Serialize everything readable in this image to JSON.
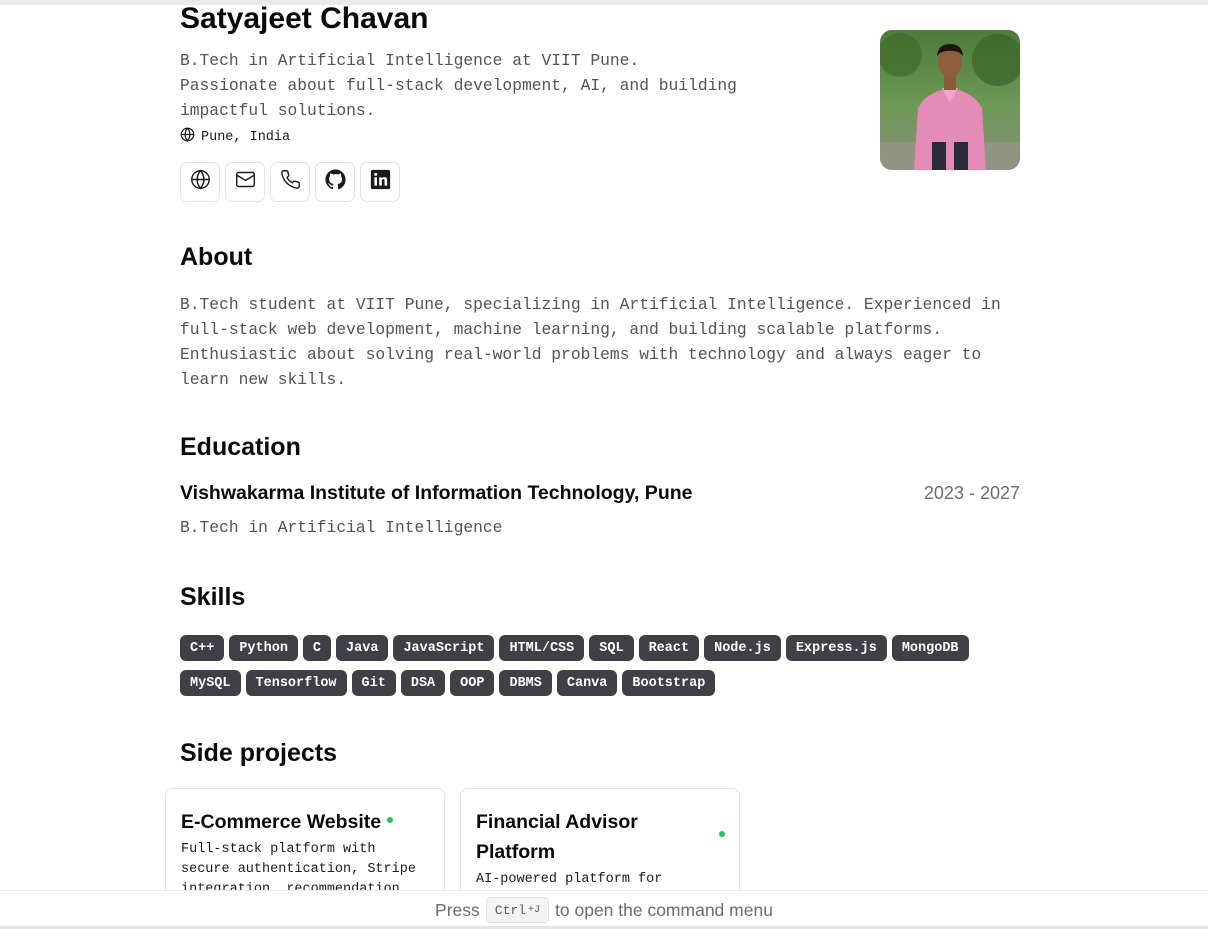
{
  "profile": {
    "name": "Satyajeet Chavan",
    "tagline_lines": [
      "B.Tech in Artificial Intelligence at VIIT Pune.",
      "Passionate about full-stack development, AI, and building",
      "impactful solutions."
    ],
    "location": "Pune, India",
    "socials": [
      {
        "icon": "globe-icon"
      },
      {
        "icon": "mail-icon"
      },
      {
        "icon": "phone-icon"
      },
      {
        "icon": "github-icon"
      },
      {
        "icon": "linkedin-icon"
      }
    ]
  },
  "about": {
    "heading": "About",
    "lines": [
      "B.Tech student at VIIT Pune, specializing in Artificial Intelligence. Experienced in",
      "full-stack web development, machine learning, and building scalable platforms.",
      "Enthusiastic about solving real-world problems with technology and always eager to",
      "learn new skills."
    ]
  },
  "education": {
    "heading": "Education",
    "school": "Vishwakarma Institute of Information Technology, Pune",
    "dates": "2023 - 2027",
    "degree": "B.Tech in Artificial Intelligence"
  },
  "skills": {
    "heading": "Skills",
    "items": [
      "C++",
      "Python",
      "C",
      "Java",
      "JavaScript",
      "HTML/CSS",
      "SQL",
      "React",
      "Node.js",
      "Express.js",
      "MongoDB",
      "MySQL",
      "Tensorflow",
      "Git",
      "DSA",
      "OOP",
      "DBMS",
      "Canva",
      "Bootstrap"
    ]
  },
  "projects": {
    "heading": "Side projects",
    "items": [
      {
        "title_lines": [
          "E-Commerce Website"
        ],
        "desc_lines": [
          "Full-stack platform with",
          "secure authentication, Stripe",
          "integration, recommendation"
        ],
        "status_color": "#22c55e"
      },
      {
        "title_lines": [
          "Financial Advisor",
          "Platform"
        ],
        "desc_lines": [
          "AI-powered platform for"
        ],
        "status_color": "#22c55e"
      }
    ]
  },
  "command_bar": {
    "prefix": "Press",
    "key": "Ctrl",
    "key_suffix": "+J",
    "suffix": "to open the command menu"
  }
}
